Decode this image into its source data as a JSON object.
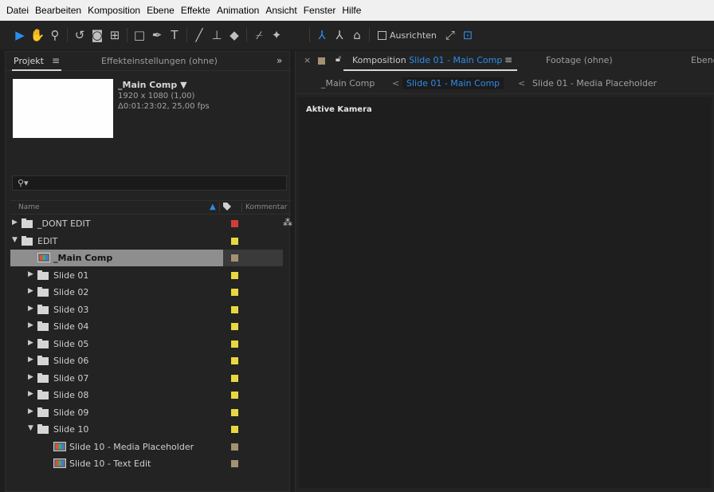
{
  "menu": [
    "Datei",
    "Bearbeiten",
    "Komposition",
    "Ebene",
    "Effekte",
    "Animation",
    "Ansicht",
    "Fenster",
    "Hilfe"
  ],
  "toolbar": {
    "tools": [
      "selection-tool",
      "hand-tool",
      "zoom-tool",
      "rotate-tool",
      "camera-tool",
      "pan-behind-tool",
      "rectangle-tool",
      "pen-tool",
      "type-tool",
      "brush-tool",
      "clone-stamp-tool",
      "eraser-tool",
      "roto-brush-tool",
      "puppet-pin-tool"
    ],
    "align_label": "Ausrichten"
  },
  "project_panel": {
    "tab_label": "Projekt",
    "effects_tab_label": "Effekteinstellungen (ohne)",
    "comp_name": "_Main Comp ▼",
    "comp_size": "1920 x 1080 (1,00)",
    "comp_duration": "Δ0:01:23:02, 25,00 fps",
    "column_name": "Name",
    "column_comment": "Kommentar",
    "items": [
      {
        "label": "_DONT EDIT",
        "type": "folder",
        "expanded": false,
        "indent": 0,
        "color": "#d23c3c"
      },
      {
        "label": "EDIT",
        "type": "folder",
        "expanded": true,
        "indent": 0,
        "color": "#e8d840"
      },
      {
        "label": "_Main Comp",
        "type": "comp",
        "indent": 1,
        "color": "#a39272",
        "selected": true
      },
      {
        "label": "Slide 01",
        "type": "folder",
        "expanded": false,
        "indent": 1,
        "color": "#e8d840"
      },
      {
        "label": "Slide 02",
        "type": "folder",
        "expanded": false,
        "indent": 1,
        "color": "#e8d840"
      },
      {
        "label": "Slide 03",
        "type": "folder",
        "expanded": false,
        "indent": 1,
        "color": "#e8d840"
      },
      {
        "label": "Slide 04",
        "type": "folder",
        "expanded": false,
        "indent": 1,
        "color": "#e8d840"
      },
      {
        "label": "Slide 05",
        "type": "folder",
        "expanded": false,
        "indent": 1,
        "color": "#e8d840"
      },
      {
        "label": "Slide 06",
        "type": "folder",
        "expanded": false,
        "indent": 1,
        "color": "#e8d840"
      },
      {
        "label": "Slide 07",
        "type": "folder",
        "expanded": false,
        "indent": 1,
        "color": "#e8d840"
      },
      {
        "label": "Slide 08",
        "type": "folder",
        "expanded": false,
        "indent": 1,
        "color": "#e8d840"
      },
      {
        "label": "Slide 09",
        "type": "folder",
        "expanded": false,
        "indent": 1,
        "color": "#e8d840"
      },
      {
        "label": "Slide 10",
        "type": "folder",
        "expanded": true,
        "indent": 1,
        "color": "#e8d840"
      },
      {
        "label": "Slide 10 - Media Placeholder",
        "type": "comp",
        "indent": 2,
        "color": "#a39272"
      },
      {
        "label": "Slide 10 - Text Edit",
        "type": "comp",
        "indent": 2,
        "color": "#a39272"
      }
    ]
  },
  "composition_panel": {
    "close": "×",
    "tab_prefix": "Komposition",
    "tab_comp": "Slide 01 - Main Comp",
    "footage_tab": "Footage (ohne)",
    "layer_tab": "Ebene",
    "breadcrumbs": [
      "_Main Comp",
      "Slide 01 - Main Comp",
      "Slide 01 - Media Placeholder"
    ],
    "active_crumb": 1,
    "crumb_separator": "<",
    "camera_label": "Aktive Kamera"
  },
  "colors": {
    "accent": "#2d8ceb",
    "label_red": "#d23c3c",
    "label_yellow": "#e8d840",
    "label_tan": "#a39272"
  }
}
